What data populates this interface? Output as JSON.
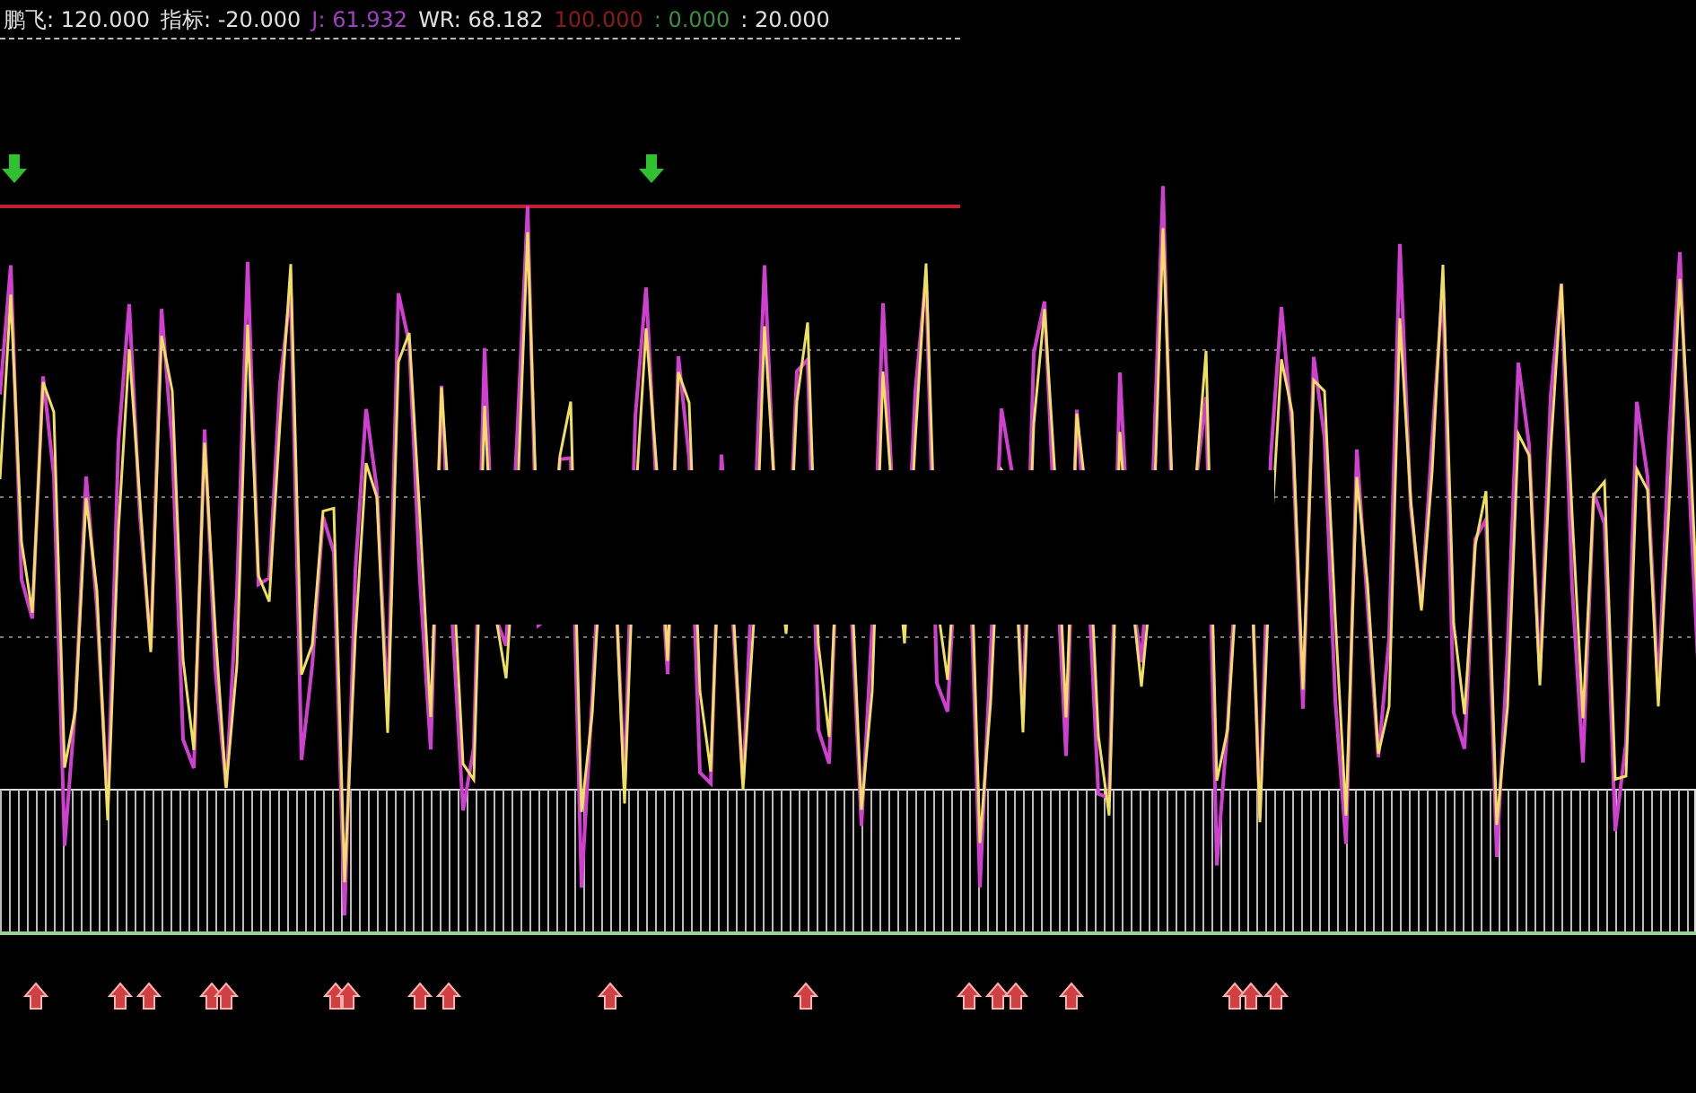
{
  "indicator_header": {
    "items": [
      {
        "text": "鹏飞: 120.000",
        "color": "#e0e0e0"
      },
      {
        "text": "指标: -20.000",
        "color": "#e0e0e0"
      },
      {
        "text": "J: 61.932",
        "color": "#a040c0"
      },
      {
        "text": "WR: 68.182",
        "color": "#e0e0e0"
      },
      {
        "text": "100.000",
        "color": "#8a1c1c"
      },
      {
        "text": ": 0.000",
        "color": "#3f8f3f"
      },
      {
        "text": ": 20.000",
        "color": "#e0e0e0"
      }
    ]
  }
}
